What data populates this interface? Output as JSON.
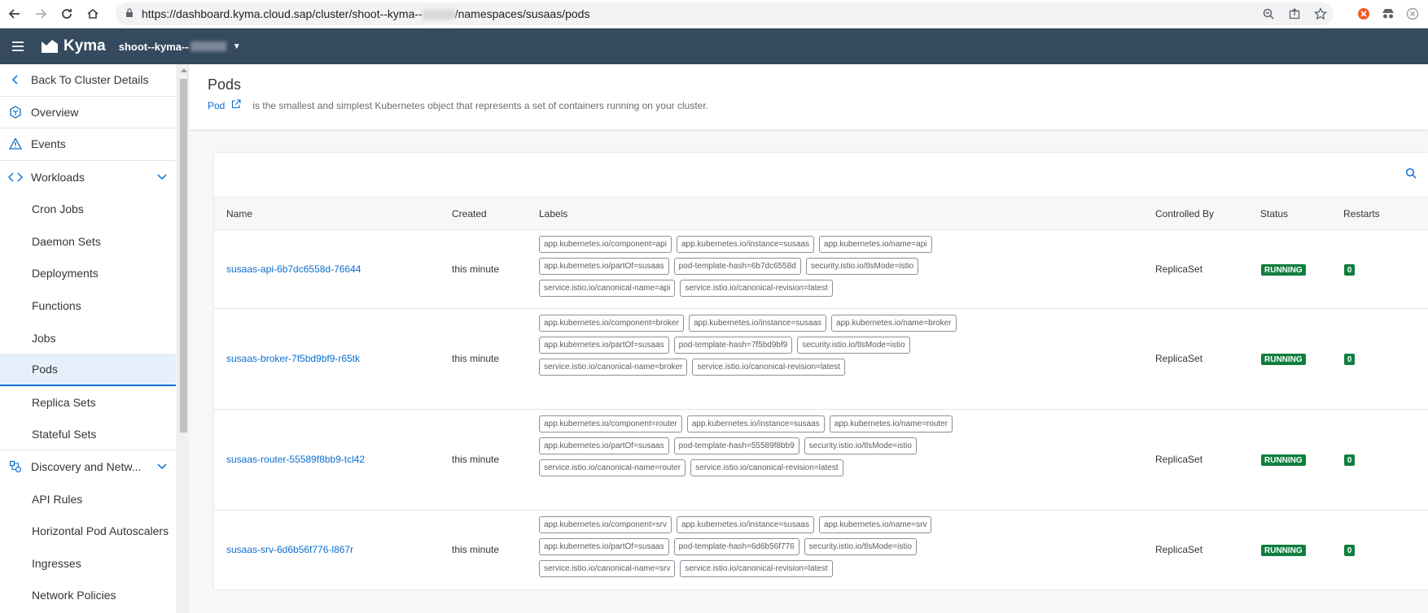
{
  "browser": {
    "url_prefix": "https://dashboard.kyma.cloud.sap/cluster/shoot--kyma--",
    "url_suffix": "/namespaces/susaas/pods"
  },
  "shellbar": {
    "product": "Kyma",
    "cluster_name": "shoot--kyma--"
  },
  "sidebar": {
    "back_label": "Back To Cluster Details",
    "items": [
      {
        "label": "Overview",
        "icon": "namespace-icon"
      },
      {
        "label": "Events",
        "icon": "warning-icon"
      },
      {
        "label": "Workloads",
        "icon": "code-icon",
        "expanded": true
      },
      {
        "label": "Cron Jobs"
      },
      {
        "label": "Daemon Sets"
      },
      {
        "label": "Deployments"
      },
      {
        "label": "Functions"
      },
      {
        "label": "Jobs"
      },
      {
        "label": "Pods",
        "selected": true
      },
      {
        "label": "Replica Sets"
      },
      {
        "label": "Stateful Sets"
      },
      {
        "label": "Discovery and Netw...",
        "icon": "network-icon",
        "expanded": true
      },
      {
        "label": "API Rules"
      },
      {
        "label": "Horizontal Pod Autoscalers"
      },
      {
        "label": "Ingresses"
      },
      {
        "label": "Network Policies"
      }
    ]
  },
  "header": {
    "title": "Pods",
    "link_text": "Pod",
    "description": "is the smallest and simplest Kubernetes object that represents a set of containers running on your cluster."
  },
  "table": {
    "columns": {
      "name": "Name",
      "created": "Created",
      "labels": "Labels",
      "controlled_by": "Controlled By",
      "status": "Status",
      "restarts": "Restarts"
    },
    "rows": [
      {
        "name": "susaas-api-6b7dc6558d-76644",
        "created": "this minute",
        "labels": [
          "app.kubernetes.io/component=api",
          "app.kubernetes.io/instance=susaas",
          "app.kubernetes.io/name=api",
          "app.kubernetes.io/partOf=susaas",
          "pod-template-hash=6b7dc6558d",
          "security.istio.io/tlsMode=istio",
          "service.istio.io/canonical-name=api",
          "service.istio.io/canonical-revision=latest"
        ],
        "controlled_by": "ReplicaSet",
        "status": "RUNNING",
        "restarts": "0"
      },
      {
        "name": "susaas-broker-7f5bd9bf9-r65tk",
        "created": "this minute",
        "labels": [
          "app.kubernetes.io/component=broker",
          "app.kubernetes.io/instance=susaas",
          "app.kubernetes.io/name=broker",
          "app.kubernetes.io/partOf=susaas",
          "pod-template-hash=7f5bd9bf9",
          "security.istio.io/tlsMode=istio",
          "service.istio.io/canonical-name=broker",
          "service.istio.io/canonical-revision=latest"
        ],
        "controlled_by": "ReplicaSet",
        "status": "RUNNING",
        "restarts": "0"
      },
      {
        "name": "susaas-router-55589f8bb9-tcl42",
        "created": "this minute",
        "labels": [
          "app.kubernetes.io/component=router",
          "app.kubernetes.io/instance=susaas",
          "app.kubernetes.io/name=router",
          "app.kubernetes.io/partOf=susaas",
          "pod-template-hash=55589f8bb9",
          "security.istio.io/tlsMode=istio",
          "service.istio.io/canonical-name=router",
          "service.istio.io/canonical-revision=latest"
        ],
        "controlled_by": "ReplicaSet",
        "status": "RUNNING",
        "restarts": "0"
      },
      {
        "name": "susaas-srv-6d6b56f776-l867r",
        "created": "this minute",
        "labels": [
          "app.kubernetes.io/component=srv",
          "app.kubernetes.io/instance=susaas",
          "app.kubernetes.io/name=srv",
          "app.kubernetes.io/partOf=susaas",
          "pod-template-hash=6d6b56f776",
          "security.istio.io/tlsMode=istio",
          "service.istio.io/canonical-name=srv",
          "service.istio.io/canonical-revision=latest"
        ],
        "controlled_by": "ReplicaSet",
        "status": "RUNNING",
        "restarts": "0"
      }
    ]
  },
  "colors": {
    "shellbar": "#354a5f",
    "accent": "#0a6ed1",
    "status_running": "#107e3e"
  }
}
